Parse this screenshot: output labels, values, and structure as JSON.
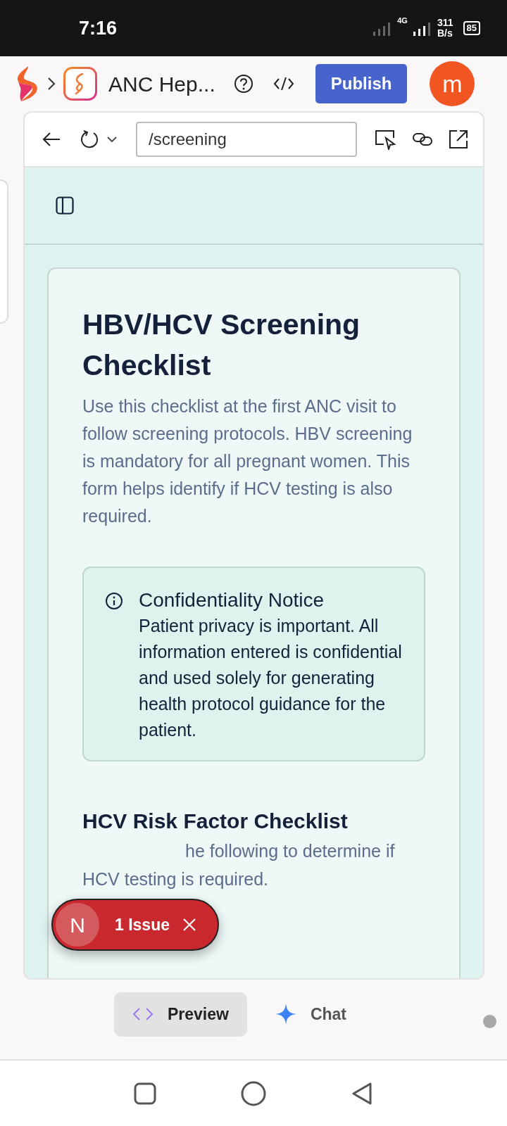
{
  "status_bar": {
    "time": "7:16",
    "network": "4G",
    "speed_value": "311",
    "speed_unit": "B/s",
    "battery": "85"
  },
  "app_header": {
    "project_title": "ANC Hep...",
    "publish_button": "Publish",
    "avatar_letter": "m"
  },
  "browser": {
    "address": "/screening"
  },
  "page": {
    "title": "HBV/HCV Screening Checklist",
    "intro": "Use this checklist at the first ANC visit to follow screening protocols. HBV screening is mandatory for all pregnant women. This form helps identify if HCV testing is also required.",
    "notice": {
      "title": "Confidentiality Notice",
      "body": "Patient privacy is important. All information entered is confidential and used solely for generating health protocol guidance for the patient."
    },
    "section_title": "HCV Risk Factor Checklist",
    "section_text": "he following to determine if HCV testing is required."
  },
  "issue_badge": {
    "letter": "N",
    "label": "1 Issue"
  },
  "bottom_tabs": [
    {
      "label": "Preview",
      "selected": true
    },
    {
      "label": "Chat",
      "selected": false
    }
  ]
}
